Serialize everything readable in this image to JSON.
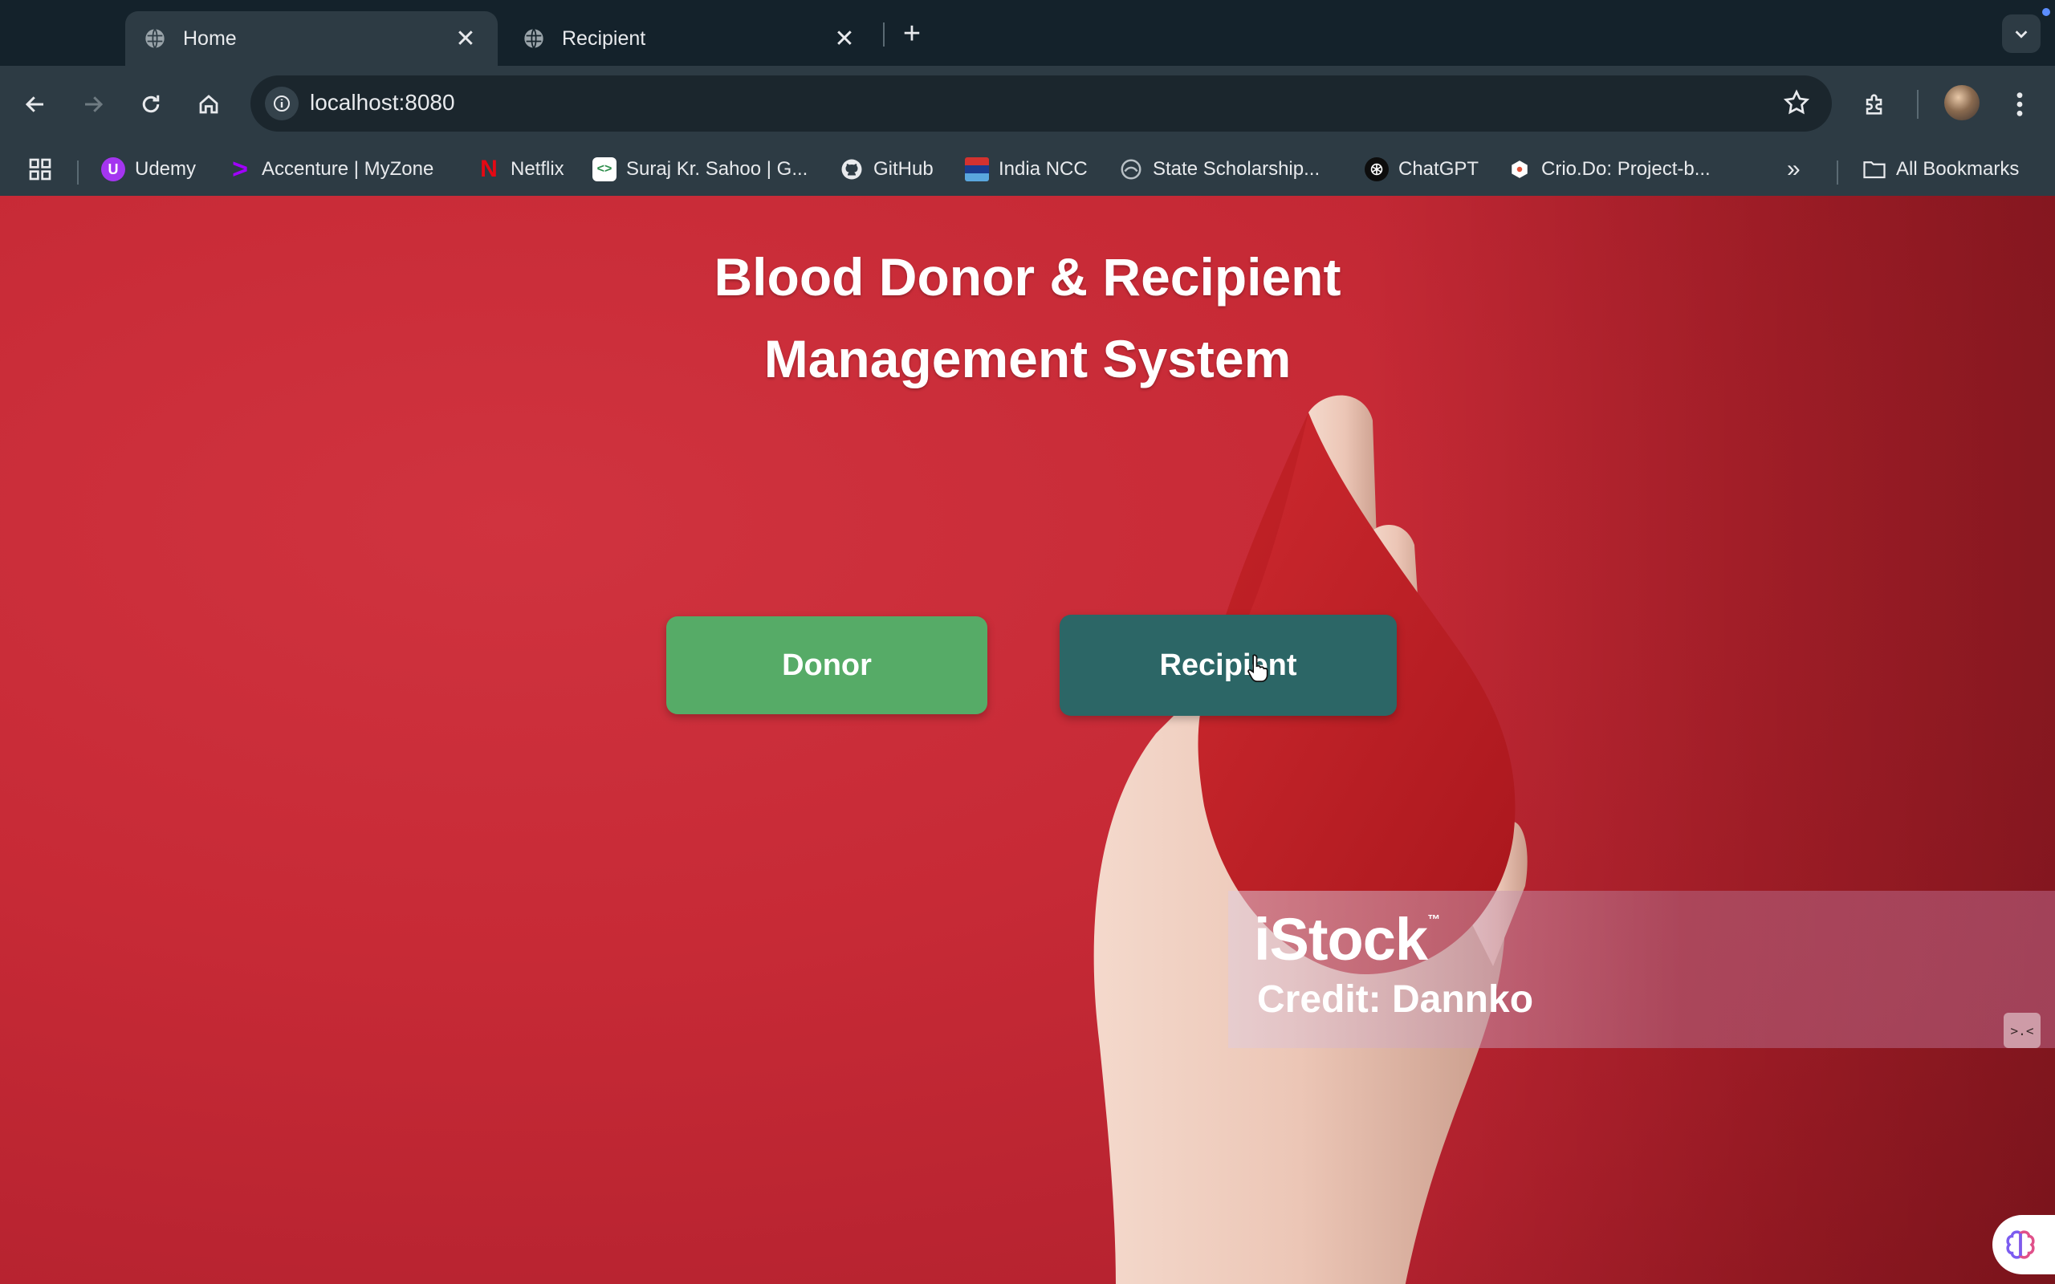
{
  "tabs": [
    {
      "title": "Home",
      "active": true
    },
    {
      "title": "Recipient",
      "active": false
    }
  ],
  "address_bar": {
    "url": "localhost:8080"
  },
  "bookmarks": [
    {
      "label": "Udemy",
      "icon": "udemy-icon"
    },
    {
      "label": "Accenture | MyZone",
      "icon": "accenture-icon"
    },
    {
      "label": "Netflix",
      "icon": "netflix-icon"
    },
    {
      "label": "Suraj Kr. Sahoo | G...",
      "icon": "code-icon"
    },
    {
      "label": "GitHub",
      "icon": "github-icon"
    },
    {
      "label": "India NCC",
      "icon": "ncc-icon"
    },
    {
      "label": "State Scholarship...",
      "icon": "scholarship-icon"
    },
    {
      "label": "ChatGPT",
      "icon": "chatgpt-icon"
    },
    {
      "label": "Crio.Do: Project-b...",
      "icon": "crio-icon"
    }
  ],
  "all_bookmarks_label": "All Bookmarks",
  "page": {
    "heading_line1": "Blood Donor & Recipient",
    "heading_line2": "Management System",
    "donor_button": "Donor",
    "recipient_button": "Recipient"
  },
  "watermark": {
    "brand": "iStock",
    "trademark": "™",
    "credit": "Credit: Dannko"
  },
  "colors": {
    "page_background": "#c72a36",
    "donor_button": "#56ab67",
    "recipient_button": "#2c6666",
    "browser_chrome": "#2d3b44"
  }
}
